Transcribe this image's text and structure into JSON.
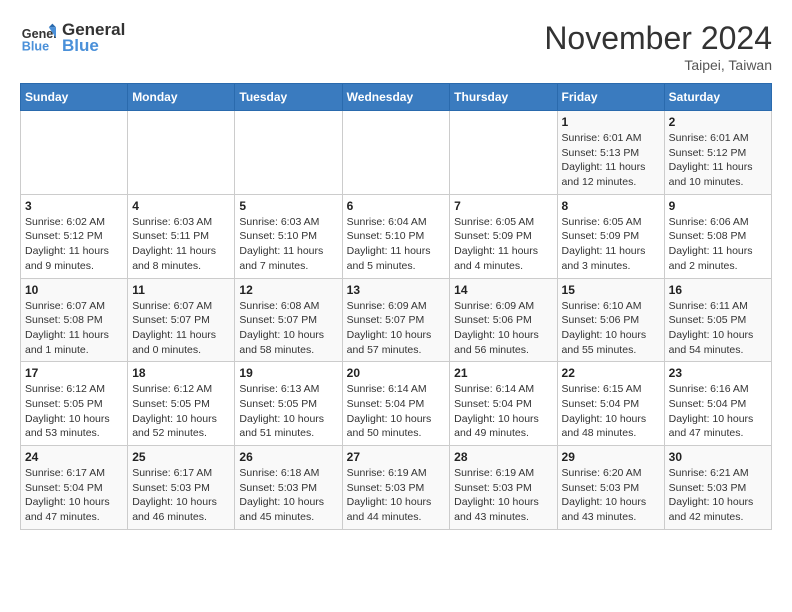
{
  "header": {
    "logo_line1": "General",
    "logo_line2": "Blue",
    "month": "November 2024",
    "location": "Taipei, Taiwan"
  },
  "weekdays": [
    "Sunday",
    "Monday",
    "Tuesday",
    "Wednesday",
    "Thursday",
    "Friday",
    "Saturday"
  ],
  "weeks": [
    [
      {
        "day": "",
        "info": ""
      },
      {
        "day": "",
        "info": ""
      },
      {
        "day": "",
        "info": ""
      },
      {
        "day": "",
        "info": ""
      },
      {
        "day": "",
        "info": ""
      },
      {
        "day": "1",
        "info": "Sunrise: 6:01 AM\nSunset: 5:13 PM\nDaylight: 11 hours and 12 minutes."
      },
      {
        "day": "2",
        "info": "Sunrise: 6:01 AM\nSunset: 5:12 PM\nDaylight: 11 hours and 10 minutes."
      }
    ],
    [
      {
        "day": "3",
        "info": "Sunrise: 6:02 AM\nSunset: 5:12 PM\nDaylight: 11 hours and 9 minutes."
      },
      {
        "day": "4",
        "info": "Sunrise: 6:03 AM\nSunset: 5:11 PM\nDaylight: 11 hours and 8 minutes."
      },
      {
        "day": "5",
        "info": "Sunrise: 6:03 AM\nSunset: 5:10 PM\nDaylight: 11 hours and 7 minutes."
      },
      {
        "day": "6",
        "info": "Sunrise: 6:04 AM\nSunset: 5:10 PM\nDaylight: 11 hours and 5 minutes."
      },
      {
        "day": "7",
        "info": "Sunrise: 6:05 AM\nSunset: 5:09 PM\nDaylight: 11 hours and 4 minutes."
      },
      {
        "day": "8",
        "info": "Sunrise: 6:05 AM\nSunset: 5:09 PM\nDaylight: 11 hours and 3 minutes."
      },
      {
        "day": "9",
        "info": "Sunrise: 6:06 AM\nSunset: 5:08 PM\nDaylight: 11 hours and 2 minutes."
      }
    ],
    [
      {
        "day": "10",
        "info": "Sunrise: 6:07 AM\nSunset: 5:08 PM\nDaylight: 11 hours and 1 minute."
      },
      {
        "day": "11",
        "info": "Sunrise: 6:07 AM\nSunset: 5:07 PM\nDaylight: 11 hours and 0 minutes."
      },
      {
        "day": "12",
        "info": "Sunrise: 6:08 AM\nSunset: 5:07 PM\nDaylight: 10 hours and 58 minutes."
      },
      {
        "day": "13",
        "info": "Sunrise: 6:09 AM\nSunset: 5:07 PM\nDaylight: 10 hours and 57 minutes."
      },
      {
        "day": "14",
        "info": "Sunrise: 6:09 AM\nSunset: 5:06 PM\nDaylight: 10 hours and 56 minutes."
      },
      {
        "day": "15",
        "info": "Sunrise: 6:10 AM\nSunset: 5:06 PM\nDaylight: 10 hours and 55 minutes."
      },
      {
        "day": "16",
        "info": "Sunrise: 6:11 AM\nSunset: 5:05 PM\nDaylight: 10 hours and 54 minutes."
      }
    ],
    [
      {
        "day": "17",
        "info": "Sunrise: 6:12 AM\nSunset: 5:05 PM\nDaylight: 10 hours and 53 minutes."
      },
      {
        "day": "18",
        "info": "Sunrise: 6:12 AM\nSunset: 5:05 PM\nDaylight: 10 hours and 52 minutes."
      },
      {
        "day": "19",
        "info": "Sunrise: 6:13 AM\nSunset: 5:05 PM\nDaylight: 10 hours and 51 minutes."
      },
      {
        "day": "20",
        "info": "Sunrise: 6:14 AM\nSunset: 5:04 PM\nDaylight: 10 hours and 50 minutes."
      },
      {
        "day": "21",
        "info": "Sunrise: 6:14 AM\nSunset: 5:04 PM\nDaylight: 10 hours and 49 minutes."
      },
      {
        "day": "22",
        "info": "Sunrise: 6:15 AM\nSunset: 5:04 PM\nDaylight: 10 hours and 48 minutes."
      },
      {
        "day": "23",
        "info": "Sunrise: 6:16 AM\nSunset: 5:04 PM\nDaylight: 10 hours and 47 minutes."
      }
    ],
    [
      {
        "day": "24",
        "info": "Sunrise: 6:17 AM\nSunset: 5:04 PM\nDaylight: 10 hours and 47 minutes."
      },
      {
        "day": "25",
        "info": "Sunrise: 6:17 AM\nSunset: 5:03 PM\nDaylight: 10 hours and 46 minutes."
      },
      {
        "day": "26",
        "info": "Sunrise: 6:18 AM\nSunset: 5:03 PM\nDaylight: 10 hours and 45 minutes."
      },
      {
        "day": "27",
        "info": "Sunrise: 6:19 AM\nSunset: 5:03 PM\nDaylight: 10 hours and 44 minutes."
      },
      {
        "day": "28",
        "info": "Sunrise: 6:19 AM\nSunset: 5:03 PM\nDaylight: 10 hours and 43 minutes."
      },
      {
        "day": "29",
        "info": "Sunrise: 6:20 AM\nSunset: 5:03 PM\nDaylight: 10 hours and 43 minutes."
      },
      {
        "day": "30",
        "info": "Sunrise: 6:21 AM\nSunset: 5:03 PM\nDaylight: 10 hours and 42 minutes."
      }
    ]
  ]
}
